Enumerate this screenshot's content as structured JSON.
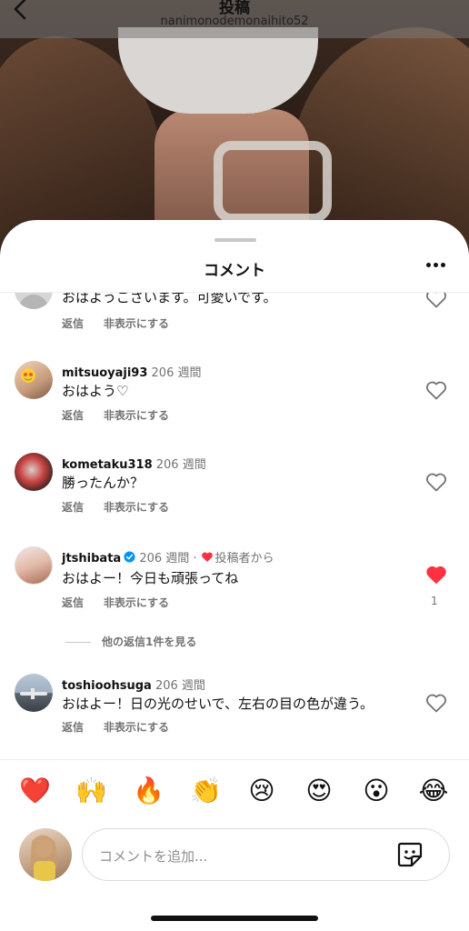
{
  "header": {
    "title": "投稿",
    "username": "nanimonodemonaihito52"
  },
  "sheet": {
    "title": "コメント"
  },
  "comments": [
    {
      "username": "",
      "time": "",
      "text": "おはようございます。可愛いです。",
      "actions": {
        "reply": "返信",
        "hide": "非表示にする"
      },
      "liked": false
    },
    {
      "username": "mitsuoyaji93",
      "time": "206 週間",
      "text": "おはよう♡",
      "actions": {
        "reply": "返信",
        "hide": "非表示にする"
      },
      "liked": false
    },
    {
      "username": "kometaku318",
      "time": "206 週間",
      "text": "勝ったんか？",
      "actions": {
        "reply": "返信",
        "hide": "非表示にする"
      },
      "liked": false
    },
    {
      "username": "jtshibata",
      "time": "206 週間",
      "author_tag": "投稿者から",
      "text": "おはよー！今日も頑張ってね",
      "actions": {
        "reply": "返信",
        "hide": "非表示にする"
      },
      "liked": true,
      "like_count": "1",
      "view_replies": "他の返信1件を見る"
    },
    {
      "username": "toshioohsuga",
      "time": "206 週間",
      "text": "おはよー！日の光のせいで、左右の目の色が違う。",
      "actions": {
        "reply": "返信",
        "hide": "非表示にする"
      },
      "liked": false
    }
  ],
  "reactions": [
    {
      "emoji": "❤️",
      "name": "red-heart"
    },
    {
      "emoji": "🙌",
      "name": "raising-hands"
    },
    {
      "emoji": "🔥",
      "name": "fire"
    },
    {
      "emoji": "👏",
      "name": "clapping-hands"
    },
    {
      "emoji": "😢",
      "name": "crying-face"
    },
    {
      "emoji": "😍",
      "name": "heart-eyes"
    },
    {
      "emoji": "😮",
      "name": "surprised-face"
    },
    {
      "emoji": "😂",
      "name": "tears-of-joy"
    }
  ],
  "composer": {
    "placeholder": "コメントを追加..."
  },
  "colors": {
    "like_red": "#ff3040",
    "verified_blue": "#0095f6",
    "secondary_text": "#737373"
  },
  "icons": [
    "back-arrow-icon",
    "more-icon",
    "heart-outline-icon",
    "heart-filled-icon",
    "verified-icon",
    "sticker-icon"
  ]
}
